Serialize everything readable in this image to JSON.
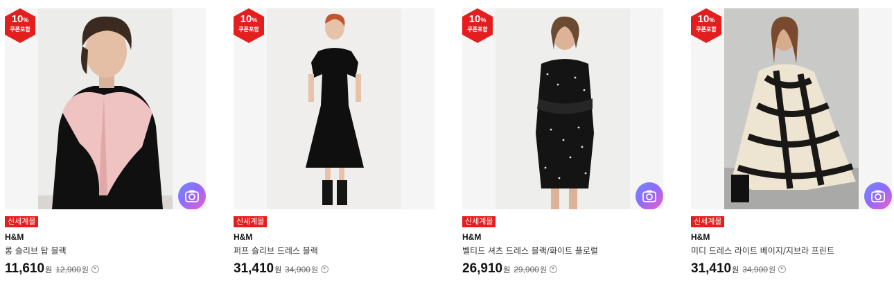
{
  "coupon": {
    "percent": "10",
    "percent_sign": "%",
    "label": "쿠폰포함",
    "color": "#e31e1e"
  },
  "camera_icon": "camera-icon",
  "products": [
    {
      "badge": "신세계몰",
      "brand": "H&M",
      "name": "롱 슬리브 탑 블랙",
      "price": "11,610",
      "currency": "원",
      "original_price": "12,900",
      "original_currency": "원"
    },
    {
      "badge": "신세계몰",
      "brand": "H&M",
      "name": "퍼프 슬리브 드레스 블랙",
      "price": "31,410",
      "currency": "원",
      "original_price": "34,900",
      "original_currency": "원"
    },
    {
      "badge": "신세계몰",
      "brand": "H&M",
      "name": "벨티드 셔츠 드레스 블랙/화이트 플로럴",
      "price": "26,910",
      "currency": "원",
      "original_price": "29,900",
      "original_currency": "원"
    },
    {
      "badge": "신세계몰",
      "brand": "H&M",
      "name": "미디 드레스 라이트 베이지/지브라 프린트",
      "price": "31,410",
      "currency": "원",
      "original_price": "34,900",
      "original_currency": "원"
    }
  ]
}
